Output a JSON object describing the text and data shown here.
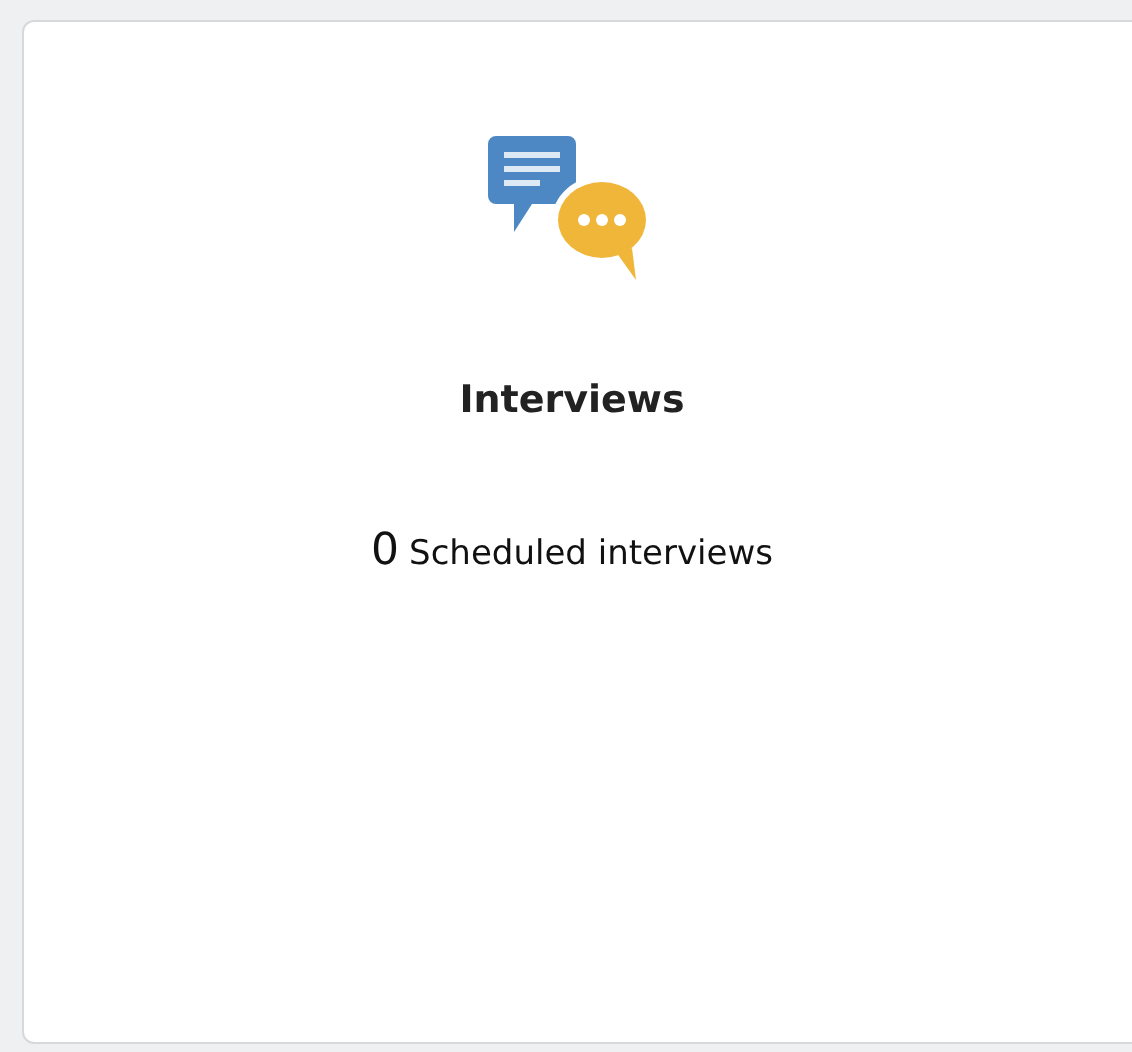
{
  "card": {
    "title": "Interviews",
    "count": "0",
    "count_label": "Scheduled interviews"
  }
}
